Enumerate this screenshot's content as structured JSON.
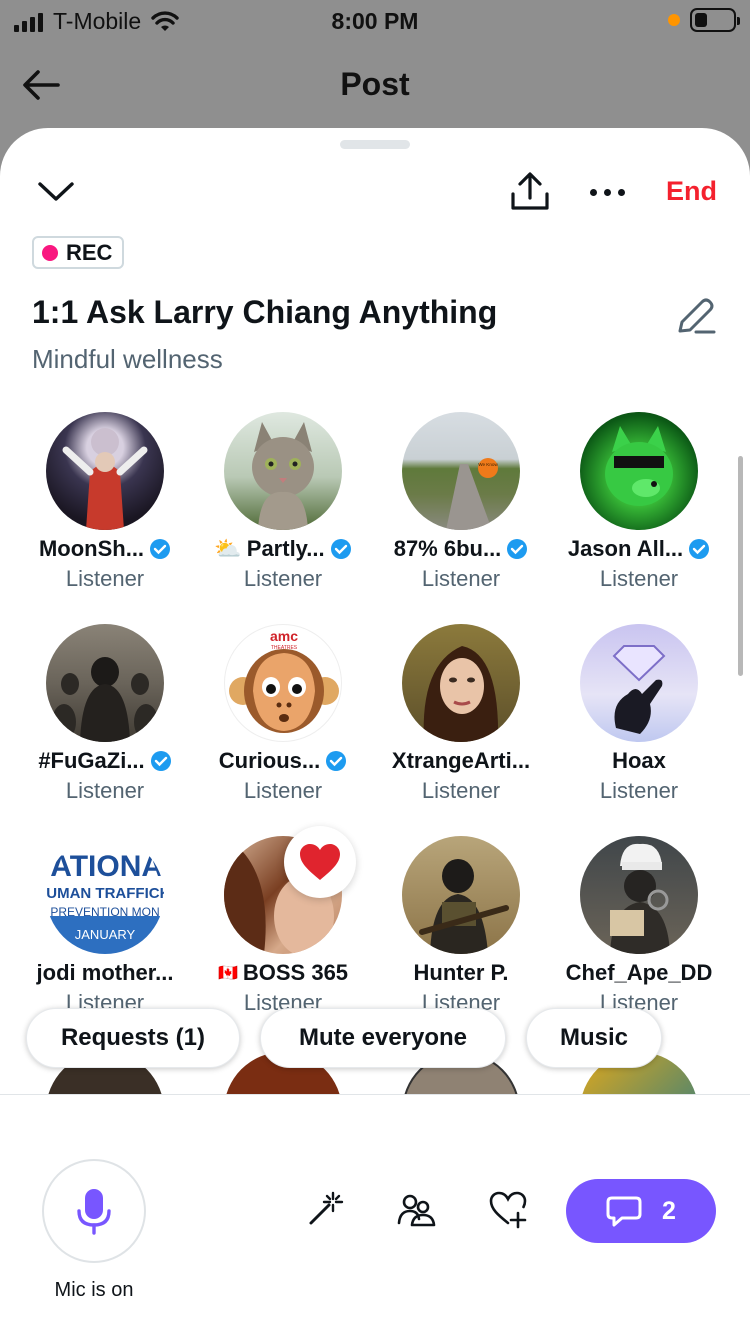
{
  "status_bar": {
    "carrier": "T-Mobile",
    "time": "8:00 PM"
  },
  "nav": {
    "title": "Post"
  },
  "space": {
    "end_label": "End",
    "rec_label": "REC",
    "title": "1:1 Ask Larry Chiang Anything",
    "subtitle": "Mindful wellness"
  },
  "participants": [
    {
      "name": "MoonSh...",
      "role": "Listener",
      "verified": true
    },
    {
      "name": "Partly...",
      "role": "Listener",
      "verified": true,
      "prefix": "⛅"
    },
    {
      "name": "87% 6bu...",
      "role": "Listener",
      "verified": true
    },
    {
      "name": "Jason All...",
      "role": "Listener",
      "verified": true
    },
    {
      "name": "#FuGaZi...",
      "role": "Listener",
      "verified": true
    },
    {
      "name": "Curious...",
      "role": "Listener",
      "verified": true
    },
    {
      "name": "XtrangeArti...",
      "role": "Listener",
      "verified": false
    },
    {
      "name": "Hoax",
      "role": "Listener",
      "verified": false
    },
    {
      "name": "jodi mother...",
      "role": "Listener",
      "verified": false
    },
    {
      "name": "BOSS 365",
      "role": "Listener",
      "verified": false,
      "prefix": "🇨🇦"
    },
    {
      "name": "Hunter P.",
      "role": "Listener",
      "verified": false
    },
    {
      "name": "Chef_Ape_DD",
      "role": "Listener",
      "verified": false
    }
  ],
  "avatar_texts": {
    "amc": "amc",
    "amc_sub": "THEATRES",
    "we_know": "We Know",
    "national_lines": [
      "NATIONAL",
      "HUMAN TRAFFICKI",
      "PREVENTION MON",
      "JANUARY"
    ]
  },
  "pills": {
    "requests": "Requests (1)",
    "mute": "Mute everyone",
    "music": "Music"
  },
  "bottom": {
    "mic_label": "Mic is on",
    "chat_count": "2"
  },
  "colors": {
    "accent_purple": "#7856ff",
    "end_red": "#f4212e",
    "rec_pink": "#f91880",
    "verified_blue": "#1d9bf0",
    "muted_text": "#536471"
  }
}
